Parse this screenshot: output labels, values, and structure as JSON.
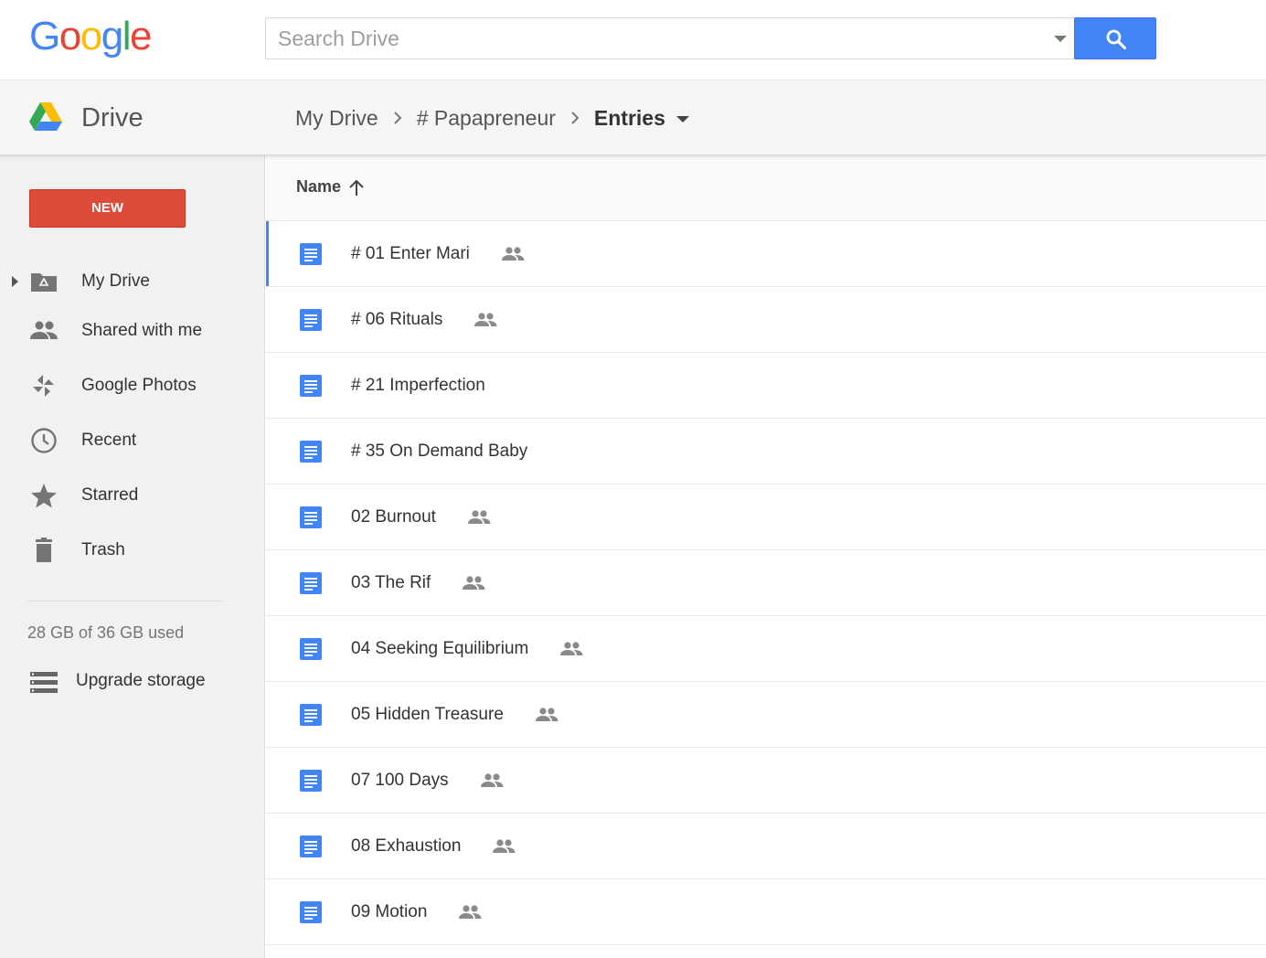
{
  "search": {
    "placeholder": "Search Drive"
  },
  "logo": {
    "text": [
      "G",
      "o",
      "o",
      "g",
      "l",
      "e"
    ],
    "colors": [
      "#4285f4",
      "#ea4335",
      "#fbbc05",
      "#4285f4",
      "#34a853",
      "#ea4335"
    ]
  },
  "header": {
    "app_title": "Drive",
    "breadcrumb": [
      "My Drive",
      "# Papapreneur",
      "Entries"
    ]
  },
  "sidebar": {
    "new_label": "NEW",
    "items": [
      {
        "label": "My Drive",
        "icon": "my-drive-folder-icon"
      },
      {
        "label": "Shared with me",
        "icon": "people-icon"
      },
      {
        "label": "Google Photos",
        "icon": "pinwheel-icon"
      },
      {
        "label": "Recent",
        "icon": "clock-icon"
      },
      {
        "label": "Starred",
        "icon": "star-icon"
      },
      {
        "label": "Trash",
        "icon": "trash-icon"
      }
    ],
    "storage_text": "28 GB of 36 GB used",
    "upgrade_label": "Upgrade storage"
  },
  "list": {
    "sort_label": "Name",
    "files": [
      {
        "name": "# 01 Enter Mari",
        "shared": true,
        "selected": true
      },
      {
        "name": "# 06 Rituals",
        "shared": true
      },
      {
        "name": "# 21 Imperfection",
        "shared": false
      },
      {
        "name": "# 35 On Demand Baby",
        "shared": false
      },
      {
        "name": "02 Burnout",
        "shared": true
      },
      {
        "name": "03 The Rif",
        "shared": true
      },
      {
        "name": "04 Seeking Equilibrium",
        "shared": true
      },
      {
        "name": "05 Hidden Treasure",
        "shared": true
      },
      {
        "name": "07 100 Days",
        "shared": true
      },
      {
        "name": "08 Exhaustion",
        "shared": true
      },
      {
        "name": "09 Motion",
        "shared": true
      }
    ]
  },
  "colors": {
    "accent_blue": "#4285f4",
    "new_red": "#dd4b39",
    "doc_blue": "#4285f4"
  }
}
